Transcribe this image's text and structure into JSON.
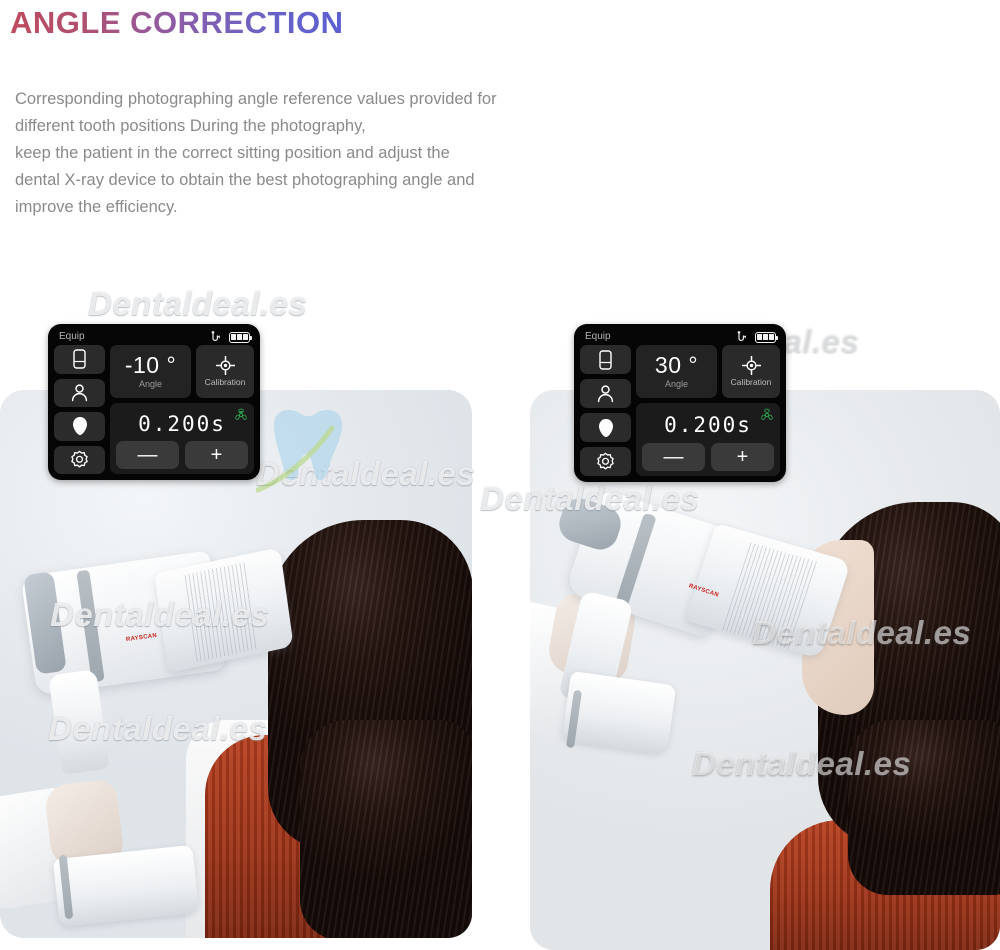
{
  "header": {
    "title_part1": "ANGLE ",
    "title_part2": "CORRECTION",
    "title_full": "ANGLE CORRECTION",
    "gradient_start": "#bf4a5c",
    "gradient_end": "#5a5fd2"
  },
  "description": {
    "line1": "Corresponding photographing angle reference values provided for",
    "line2": "different tooth positions During the photography,",
    "line3": "keep the patient in the correct sitting position and adjust the",
    "line4": "dental X-ray device to obtain the best photographing angle and",
    "line5": "improve the efficiency.",
    "color": "#8a8a8a"
  },
  "watermarks": {
    "brand": "Dentaldeal.es",
    "logo_name": "tooth-logo"
  },
  "device_panels": [
    {
      "id": "panel-left",
      "status": {
        "equip_label": "Equip",
        "cable_icon": "usb-cable-icon",
        "battery_icon": "battery-full-icon",
        "battery_cells": 3
      },
      "rail": [
        {
          "icon": "sensor-icon",
          "name": "sensor-button"
        },
        {
          "icon": "person-icon",
          "name": "patient-button"
        },
        {
          "icon": "tooth-icon",
          "name": "tooth-button"
        },
        {
          "icon": "gear-icon",
          "name": "settings-button"
        }
      ],
      "angle": {
        "value": "-10 °",
        "caption": "Angle"
      },
      "calibration": {
        "icon": "crosshair-target-icon",
        "caption": "Calibration"
      },
      "dose": {
        "value": "0.200s",
        "radiation_icon": "radiation-trefoil-icon",
        "radiation_color": "#2d9c4a",
        "minus_label": "—",
        "plus_label": "+"
      }
    },
    {
      "id": "panel-right",
      "status": {
        "equip_label": "Equip",
        "cable_icon": "usb-cable-icon",
        "battery_icon": "battery-full-icon",
        "battery_cells": 3
      },
      "rail": [
        {
          "icon": "sensor-icon",
          "name": "sensor-button"
        },
        {
          "icon": "person-icon",
          "name": "patient-button"
        },
        {
          "icon": "tooth-icon",
          "name": "tooth-button"
        },
        {
          "icon": "gear-icon",
          "name": "settings-button"
        }
      ],
      "angle": {
        "value": "30 °",
        "caption": "Angle"
      },
      "calibration": {
        "icon": "crosshair-target-icon",
        "caption": "Calibration"
      },
      "dose": {
        "value": "0.200s",
        "radiation_icon": "radiation-trefoil-icon",
        "radiation_color": "#2d9c4a",
        "minus_label": "—",
        "plus_label": "+"
      }
    }
  ],
  "photos": [
    {
      "id": "photo-left",
      "alt": "Dentist holding handheld dental X-ray device aimed at seated patient from behind",
      "device_logo": "RAYSCAN"
    },
    {
      "id": "photo-right",
      "alt": "Dentist holding handheld dental X-ray device at upward angle toward patient face",
      "device_logo": "RAYSCAN"
    }
  ]
}
